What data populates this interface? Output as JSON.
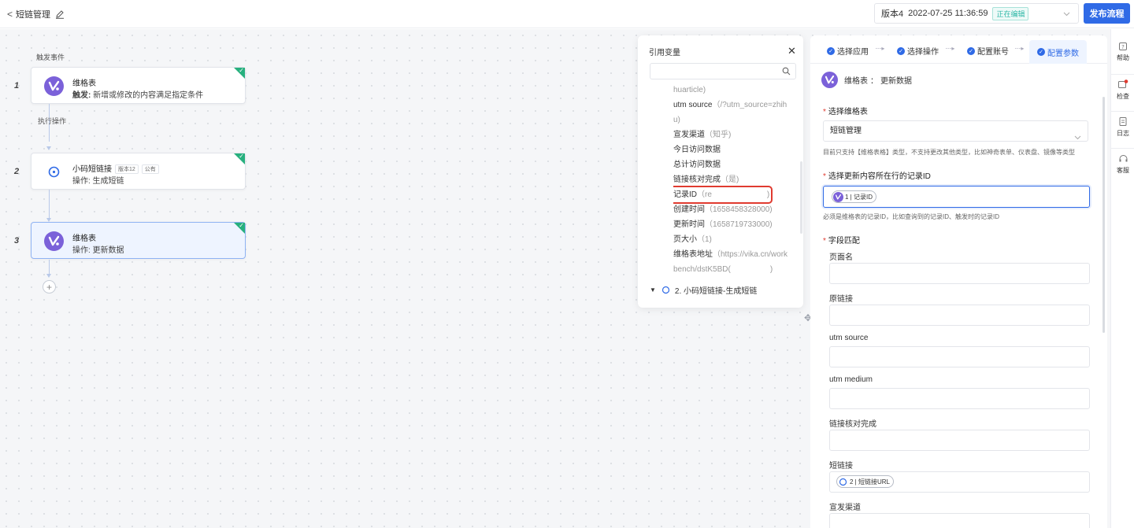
{
  "header": {
    "back_label": "短链管理",
    "version": "版本4",
    "version_date": "2022-07-25 11:36:59",
    "editing_badge": "正在编辑",
    "publish_label": "发布流程"
  },
  "canvas": {
    "trigger_section": "触发事件",
    "action_section": "执行操作",
    "nodes": [
      {
        "step": "1",
        "title": "维格表",
        "prefix": "触发:",
        "subtitle": "新增或修改的内容满足指定条件"
      },
      {
        "step": "2",
        "title": "小码短链接",
        "tag1": "版本12",
        "tag2": "公有",
        "subtitle": "操作: 生成短链"
      },
      {
        "step": "3",
        "title": "维格表",
        "subtitle": "操作: 更新数据"
      }
    ],
    "add_symbol": "+"
  },
  "var_panel": {
    "title": "引用变量",
    "close": "✕",
    "rows": [
      {
        "label": "",
        "value": "huarticle)"
      },
      {
        "label": "utm source",
        "value": "（/?utm_source=zhih"
      },
      {
        "label": "",
        "value": "u)"
      },
      {
        "label": "宣发渠道",
        "value": "（知乎)"
      },
      {
        "label": "今日访问数据",
        "value": ""
      },
      {
        "label": "总计访问数据",
        "value": ""
      },
      {
        "label": "链接核对完成",
        "value": "（是)"
      },
      {
        "label": "记录ID",
        "value": "（re　　　　　　　)"
      },
      {
        "label": "创建时间",
        "value": "（1658458328000)"
      },
      {
        "label": "更新时间",
        "value": "（1658719733000)"
      },
      {
        "label": "页大小",
        "value": "（1)"
      },
      {
        "label": "维格表地址",
        "value": "（https://vika.cn/work"
      },
      {
        "label": "",
        "value": "bench/dstK5BD(　　　　　)"
      }
    ],
    "group_label": "2. 小码短链接-生成短链"
  },
  "config": {
    "steps": [
      "选择应用",
      "选择操作",
      "配置账号",
      "配置参数"
    ],
    "header_app": "维格表",
    "header_sep": "：",
    "header_action": "更新数据",
    "datasheet_label": "选择维格表",
    "datasheet_value": "短链管理",
    "datasheet_helper": "目前只支持【维格表格】类型，不支持更改其他类型，比如神奇表单、仪表盘、镜像等类型",
    "record_label": "选择更新内容所在行的记录ID",
    "record_chip": "1 | 记录ID",
    "record_helper": "必须是维格表的记录ID，比如查询到的记录ID、触发时的记录ID",
    "mapping_label": "字段匹配",
    "fields": [
      "页面名",
      "原链接",
      "utm source",
      "utm medium",
      "链接核对完成",
      "短链接",
      "宣发渠道"
    ],
    "short_link_chip": "2 | 短链接URL"
  },
  "rail": [
    "帮助",
    "检查",
    "日志",
    "客服"
  ],
  "colors": {
    "primary": "#2f6ae6",
    "success": "#27b07e",
    "danger": "#e03b30",
    "vika": "#7b61d9"
  }
}
